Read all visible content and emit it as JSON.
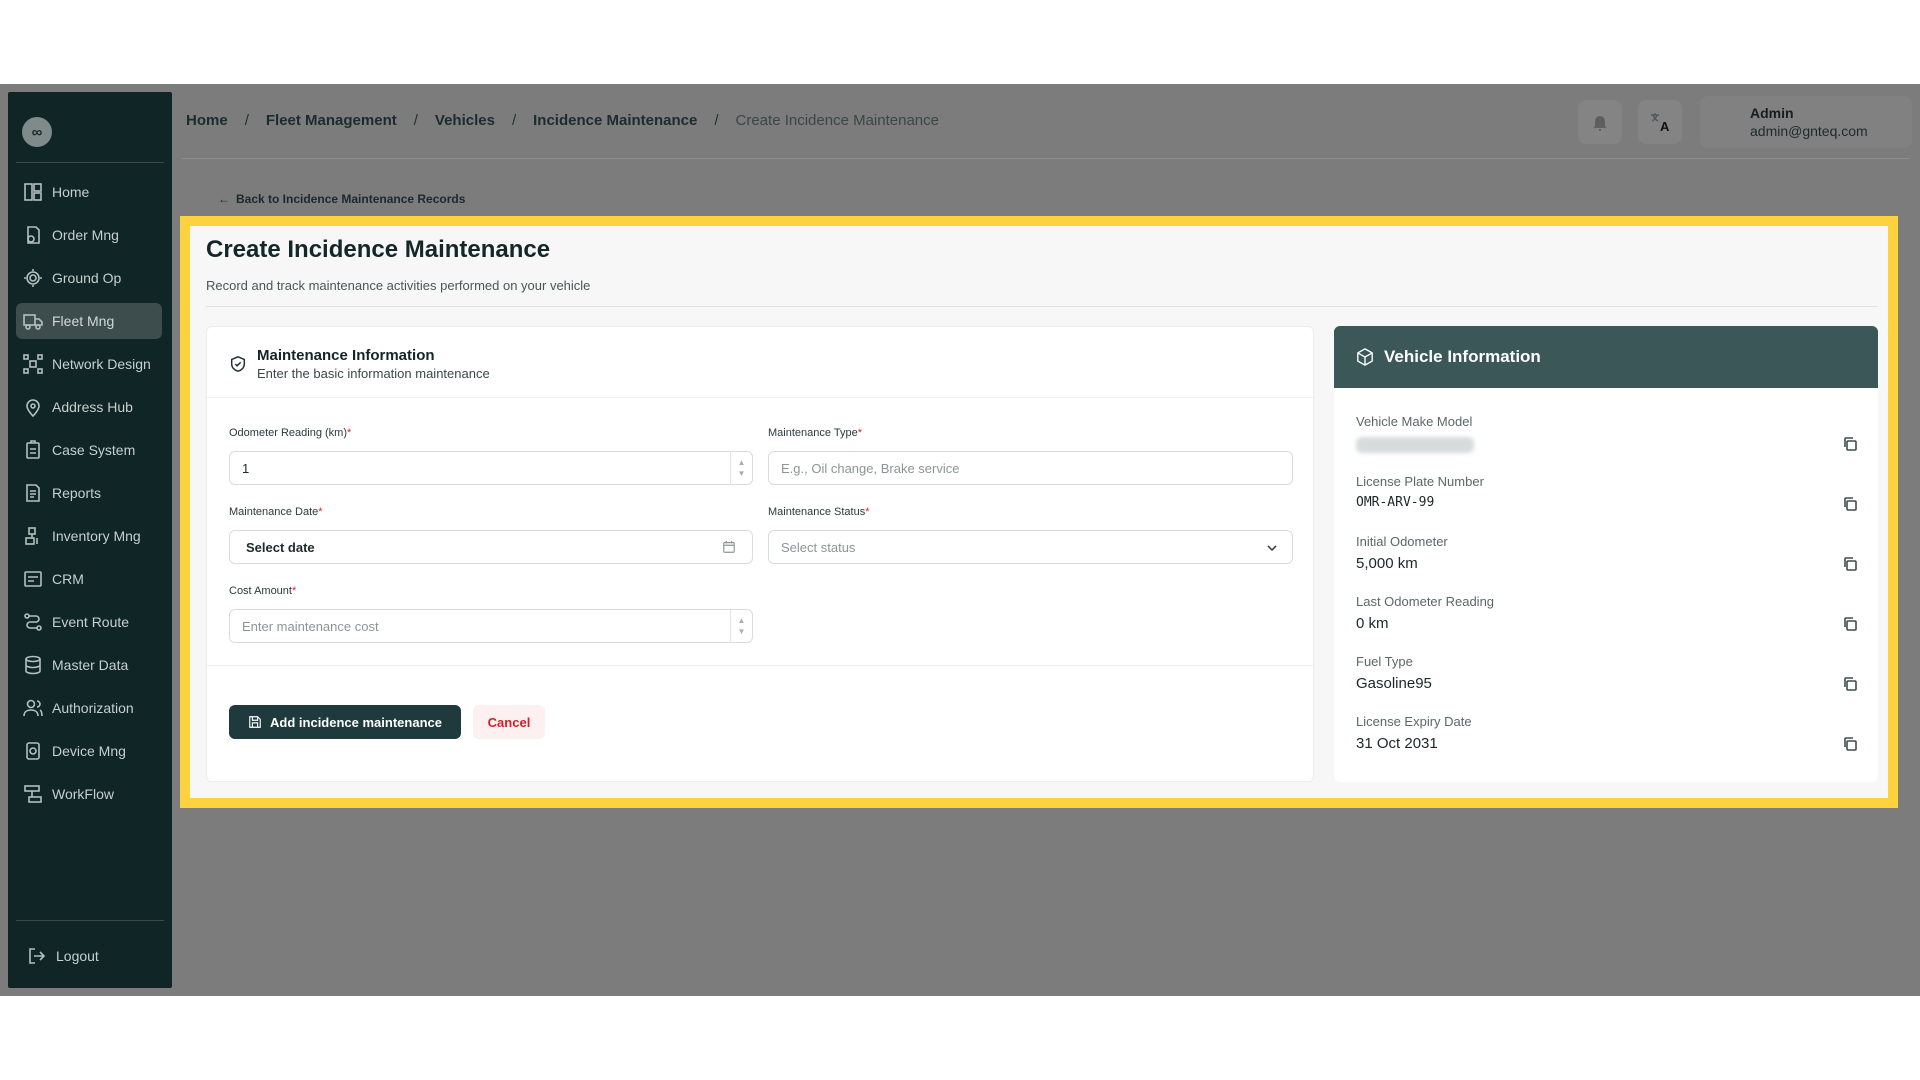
{
  "sidebar": {
    "logo_glyph": "∞",
    "items": [
      {
        "label": "Home",
        "icon": "grid-icon"
      },
      {
        "label": "Order Mng",
        "icon": "order-icon"
      },
      {
        "label": "Ground Op",
        "icon": "ground-op-icon"
      },
      {
        "label": "Fleet Mng",
        "icon": "truck-icon",
        "active": true
      },
      {
        "label": "Network Design",
        "icon": "network-icon"
      },
      {
        "label": "Address Hub",
        "icon": "location-icon"
      },
      {
        "label": "Case System",
        "icon": "case-icon"
      },
      {
        "label": "Reports",
        "icon": "report-icon"
      },
      {
        "label": "Inventory Mng",
        "icon": "inventory-icon"
      },
      {
        "label": "CRM",
        "icon": "crm-icon"
      },
      {
        "label": "Event Route",
        "icon": "route-icon"
      },
      {
        "label": "Master Data",
        "icon": "database-icon"
      },
      {
        "label": "Authorization",
        "icon": "users-icon"
      },
      {
        "label": "Device Mng",
        "icon": "device-icon"
      },
      {
        "label": "WorkFlow",
        "icon": "workflow-icon"
      }
    ],
    "logout_label": "Logout"
  },
  "breadcrumb": {
    "items": [
      "Home",
      "Fleet Management",
      "Vehicles",
      "Incidence Maintenance"
    ],
    "current": "Create Incidence Maintenance",
    "separator": "/"
  },
  "topbar": {
    "user_name": "Admin",
    "user_email": "admin@gnteq.com"
  },
  "back_link": "Back to Incidence Maintenance Records",
  "page": {
    "title": "Create Incidence Maintenance",
    "subtitle": "Record and track maintenance activities performed on your vehicle"
  },
  "form": {
    "section_title": "Maintenance Information",
    "section_subtitle": "Enter the basic information maintenance",
    "odometer": {
      "label": "Odometer Reading (km)",
      "value": "1"
    },
    "maintenance_type": {
      "label": "Maintenance Type",
      "placeholder": "E.g., Oil change, Brake service"
    },
    "maintenance_date": {
      "label": "Maintenance Date",
      "value": "Select date"
    },
    "maintenance_status": {
      "label": "Maintenance Status",
      "placeholder": "Select status"
    },
    "cost_amount": {
      "label": "Cost Amount",
      "placeholder": "Enter maintenance cost"
    },
    "required_mark": "*",
    "submit_label": "Add incidence maintenance",
    "cancel_label": "Cancel"
  },
  "vehicle": {
    "title": "Vehicle Information",
    "fields": [
      {
        "label": "Vehicle Make Model",
        "value": ""
      },
      {
        "label": "License Plate Number",
        "value": "OMR-ARV-99"
      },
      {
        "label": "Initial Odometer",
        "value": "5,000 km"
      },
      {
        "label": "Last Odometer Reading",
        "value": "0 km"
      },
      {
        "label": "Fuel Type",
        "value": "Gasoline95"
      },
      {
        "label": "License Expiry Date",
        "value": "31 Oct 2031"
      }
    ]
  },
  "colors": {
    "sidebar_bg": "#0f2526",
    "highlight": "#fdd23e",
    "primary_button": "#1e3a3c",
    "vehicle_header": "#3c5757",
    "required": "#d8262e"
  }
}
